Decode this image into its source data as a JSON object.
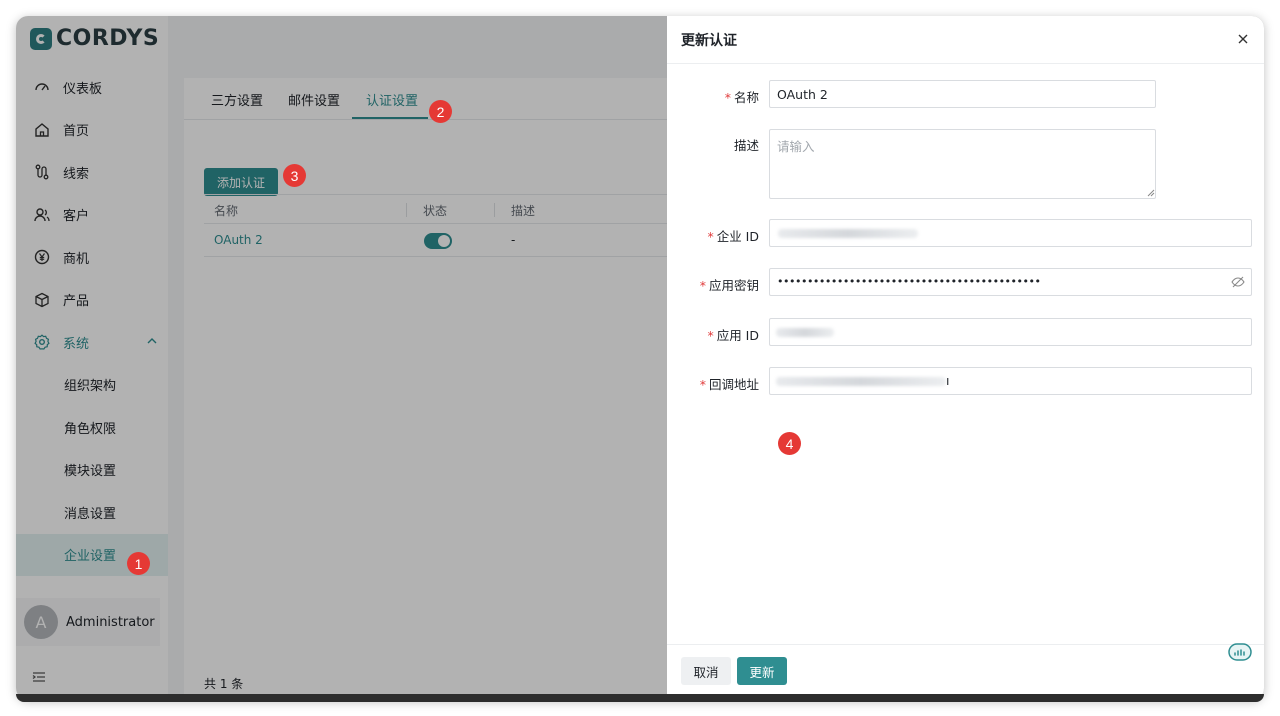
{
  "app": {
    "logo_text": "CORDYS",
    "brand_color": "#2f8e91"
  },
  "sidebar": {
    "items": [
      {
        "label": "仪表板",
        "icon": "dashboard-icon"
      },
      {
        "label": "首页",
        "icon": "home-icon"
      },
      {
        "label": "线索",
        "icon": "clue-icon"
      },
      {
        "label": "客户",
        "icon": "customer-icon"
      },
      {
        "label": "商机",
        "icon": "yen-icon"
      },
      {
        "label": "产品",
        "icon": "box-icon"
      },
      {
        "label": "系统",
        "icon": "gear-icon"
      }
    ],
    "sub_items": [
      {
        "label": "组织架构"
      },
      {
        "label": "角色权限"
      },
      {
        "label": "模块设置"
      },
      {
        "label": "消息设置"
      },
      {
        "label": "企业设置"
      }
    ],
    "user": {
      "initial": "A",
      "name": "Administrator"
    }
  },
  "main": {
    "tabs": [
      {
        "label": "三方设置"
      },
      {
        "label": "邮件设置"
      },
      {
        "label": "认证设置"
      }
    ],
    "add_button": "添加认证",
    "table": {
      "columns": [
        "名称",
        "状态",
        "描述"
      ],
      "rows": [
        {
          "name": "OAuth 2",
          "enabled": true,
          "desc": "-"
        }
      ]
    },
    "total": "共 1 条"
  },
  "drawer": {
    "title": "更新认证",
    "fields": {
      "name": {
        "label": "名称",
        "value": "OAuth 2"
      },
      "desc": {
        "label": "描述",
        "placeholder": "请输入"
      },
      "corp_id": {
        "label": "企业 ID"
      },
      "app_secret": {
        "label": "应用密钥",
        "value": "••••••••••••••••••••••••••••••••••••••••••••"
      },
      "app_id": {
        "label": "应用 ID"
      },
      "callback": {
        "label": "回调地址",
        "tail": "ı"
      }
    },
    "cancel": "取消",
    "update": "更新"
  },
  "annotations": [
    "1",
    "2",
    "3",
    "4"
  ]
}
